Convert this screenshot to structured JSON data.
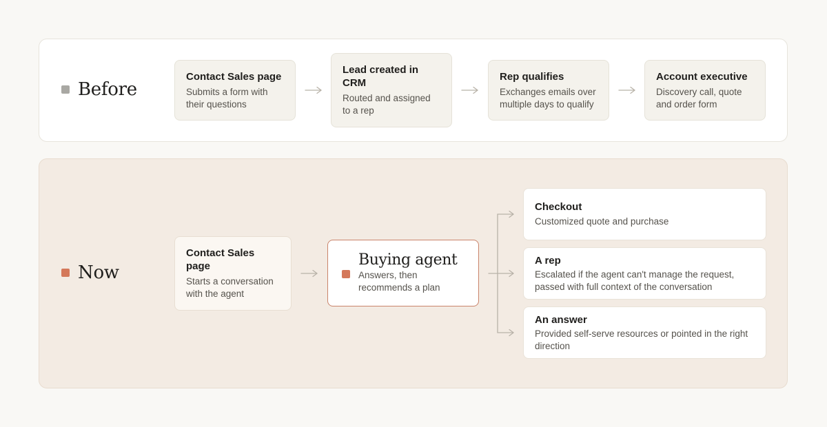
{
  "colors": {
    "page_bg": "#f9f8f5",
    "before_marker": "#a9a8a3",
    "now_marker": "#d4785a",
    "agent_border": "#c9836a",
    "arrow": "#b8b2a8"
  },
  "before": {
    "label": "Before",
    "steps": [
      {
        "title": "Contact Sales page",
        "desc": "Submits a form with their questions"
      },
      {
        "title": "Lead created in CRM",
        "desc": "Routed and assigned to a rep"
      },
      {
        "title": "Rep qualifies",
        "desc": "Exchanges emails over multiple days to qualify"
      },
      {
        "title": "Account executive",
        "desc": "Discovery call, quote and order form"
      }
    ]
  },
  "now": {
    "label": "Now",
    "start": {
      "title": "Contact Sales page",
      "desc": "Starts a conversation with the agent"
    },
    "agent": {
      "title": "Buying agent",
      "desc": "Answers, then recommends a plan"
    },
    "outcomes": [
      {
        "title": "Checkout",
        "desc": "Customized quote and purchase"
      },
      {
        "title": "A rep",
        "desc": "Escalated if the agent can't manage the request, passed with full context of the conversation"
      },
      {
        "title": "An answer",
        "desc": "Provided self-serve resources or pointed in the right direction"
      }
    ]
  }
}
